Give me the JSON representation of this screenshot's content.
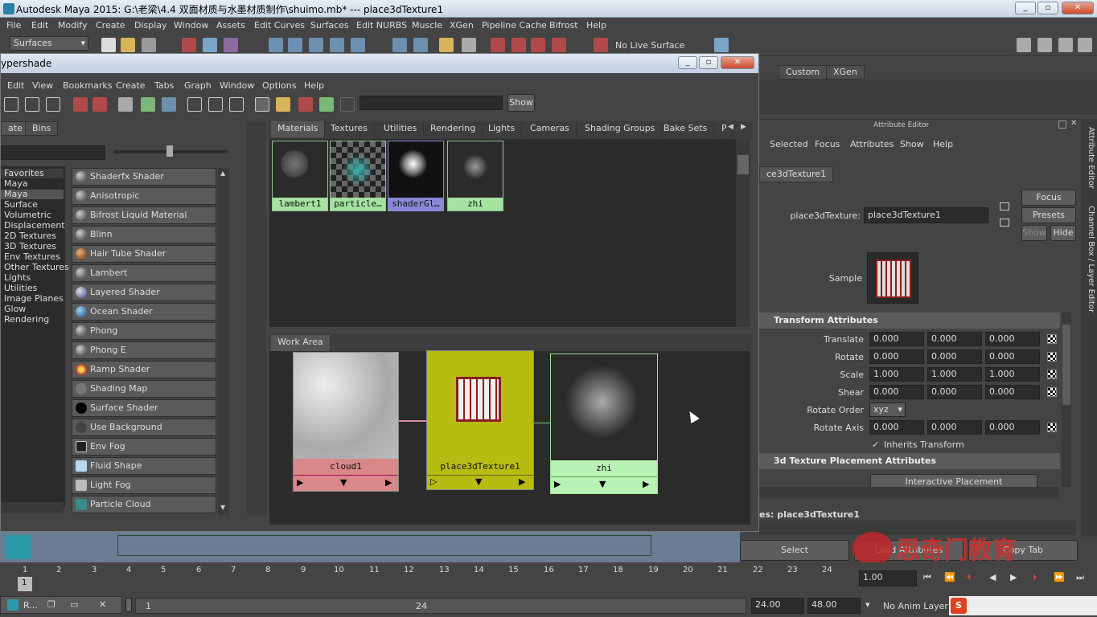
{
  "app": {
    "title": "Autodesk Maya 2015: G:\\老梁\\4.4 双面材质与水墨材质制作\\shuimo.mb*   ---   place3dTexture1"
  },
  "main_menu": [
    "File",
    "Edit",
    "Modify",
    "Create",
    "Display",
    "Window",
    "Assets",
    "Edit Curves",
    "Surfaces",
    "Edit NURBS",
    "Muscle",
    "XGen",
    "Pipeline Cache",
    "Bifrost",
    "Help"
  ],
  "shelf": {
    "menuset": "Surfaces",
    "live_surface": "No Live Surface"
  },
  "shelf_tabs_right": [
    "Custom",
    "XGen"
  ],
  "hypershade": {
    "title": "ypershade",
    "menu": [
      "Edit",
      "View",
      "Bookmarks",
      "Create",
      "Tabs",
      "Graph",
      "Window",
      "Options",
      "Help"
    ],
    "show_label": "Show",
    "left_tabs": [
      "ate",
      "Bins"
    ],
    "categories": [
      "Favorites",
      "Maya",
      "Maya",
      "Surface",
      "Volumetric",
      "Displacement",
      "2D Textures",
      "3D Textures",
      "Env Textures",
      "Other Textures",
      "Lights",
      "Utilities",
      "Image Planes",
      "Glow",
      "Rendering"
    ],
    "shaders": [
      "Shaderfx Shader",
      "Anisotropic",
      "Bifrost Liquid Material",
      "Blinn",
      "Hair Tube Shader",
      "Lambert",
      "Layered Shader",
      "Ocean Shader",
      "Phong",
      "Phong E",
      "Ramp Shader",
      "Shading Map",
      "Surface Shader",
      "Use Background",
      "Env Fog",
      "Fluid Shape",
      "Light Fog",
      "Particle Cloud"
    ],
    "tabs": [
      "Materials",
      "Textures",
      "Utilities",
      "Rendering",
      "Lights",
      "Cameras",
      "Shading Groups",
      "Bake Sets",
      "P"
    ],
    "swatches": [
      "lambert1",
      "particle…",
      "shaderGl…",
      "zhi"
    ],
    "work_area_label": "Work Area",
    "nodes": [
      "cloud1",
      "place3dTexture1",
      "zhi"
    ]
  },
  "attribute_editor": {
    "header": "Attribute Editor",
    "menu": [
      "Selected",
      "Focus",
      "Attributes",
      "Show",
      "Help"
    ],
    "node_tab": "ce3dTexture1",
    "node_type_label": "place3dTexture:",
    "node_name": "place3dTexture1",
    "focus": "Focus",
    "presets": "Presets",
    "show": "Show",
    "hide": "Hide",
    "sample_label": "Sample",
    "section_transform": "Transform Attributes",
    "translate_label": "Translate",
    "translate": [
      "0.000",
      "0.000",
      "0.000"
    ],
    "rotate_label": "Rotate",
    "rotate": [
      "0.000",
      "0.000",
      "0.000"
    ],
    "scale_label": "Scale",
    "scale": [
      "1.000",
      "1.000",
      "1.000"
    ],
    "shear_label": "Shear",
    "shear": [
      "0.000",
      "0.000",
      "0.000"
    ],
    "rotate_order_label": "Rotate Order",
    "rotate_order": "xyz",
    "rotate_axis_label": "Rotate Axis",
    "rotate_axis": [
      "0.000",
      "0.000",
      "0.000"
    ],
    "inherits_transform": "Inherits Transform",
    "section_placement": "3d Texture Placement Attributes",
    "interactive_placement": "Interactive Placement",
    "notes_label": "es:  place3dTexture1",
    "select_btn": "Select",
    "load_attributes_btn": "Load Attributes",
    "copy_tab_btn": "Copy Tab"
  },
  "side_tabs": [
    "Attribute Editor",
    "Channel Box / Layer Editor"
  ],
  "timeline": {
    "ticks": [
      "1",
      "2",
      "3",
      "4",
      "5",
      "6",
      "7",
      "8",
      "9",
      "10",
      "11",
      "12",
      "13",
      "14",
      "15",
      "16",
      "17",
      "18",
      "19",
      "20",
      "21",
      "22",
      "23",
      "24"
    ],
    "current_frame": "1.00",
    "range_start": "1",
    "range_mid_start": "1",
    "range_mid_end": "24",
    "end_time": "24.00",
    "max_time": "48.00",
    "anim_layer": "No Anim Layer"
  },
  "taskbar": {
    "item": "R..."
  },
  "watermark": "思奇门教育"
}
